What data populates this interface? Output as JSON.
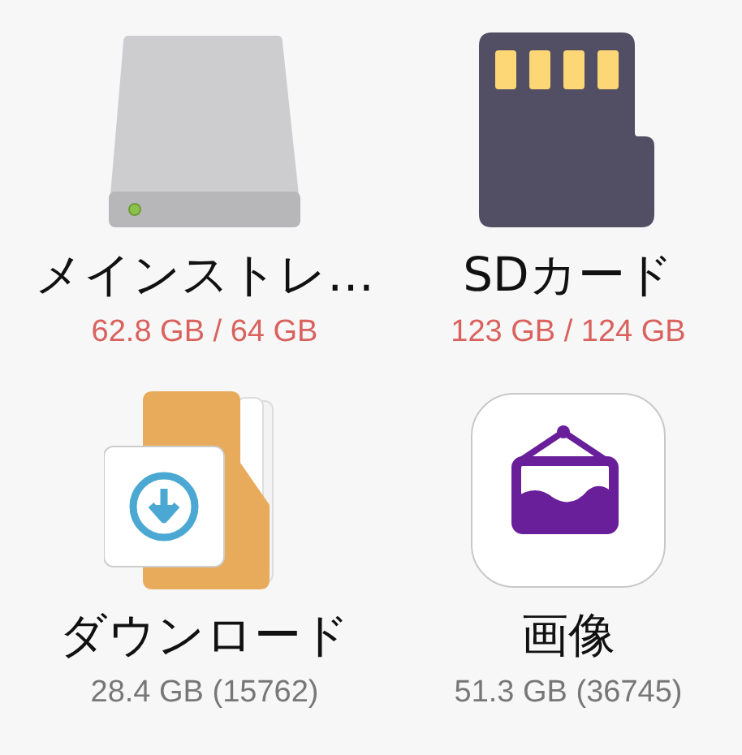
{
  "items": [
    {
      "kind": "drive",
      "name": "メインストレ…",
      "detail": "62.8 GB / 64 GB",
      "low_space": true
    },
    {
      "kind": "sdcard",
      "name": "SDカード",
      "detail": "123 GB / 124 GB",
      "low_space": true
    },
    {
      "kind": "downloads",
      "name": "ダウンロード",
      "detail": "28.4 GB (15762)",
      "low_space": false
    },
    {
      "kind": "images",
      "name": "画像",
      "detail": "51.3 GB (36745)",
      "low_space": false
    }
  ]
}
